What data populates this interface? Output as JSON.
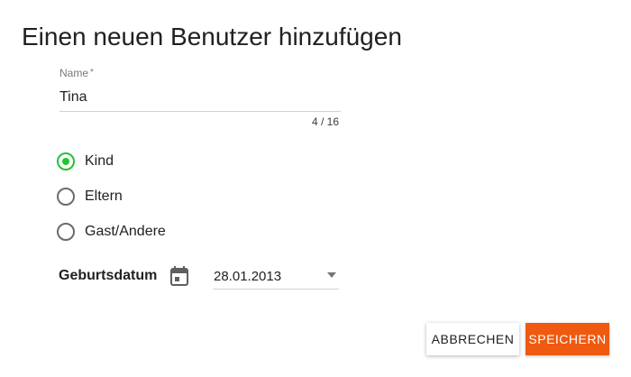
{
  "dialog": {
    "title": "Einen neuen Benutzer hinzufügen"
  },
  "name_field": {
    "label": "Name",
    "required_marker": "*",
    "value": "Tina",
    "counter": "4 / 16"
  },
  "role_options": [
    {
      "label": "Kind",
      "checked": true
    },
    {
      "label": "Eltern",
      "checked": false
    },
    {
      "label": "Gast/Andere",
      "checked": false
    }
  ],
  "birthdate": {
    "label": "Geburtsdatum",
    "value": "28.01.2013",
    "icon": "calendar-icon"
  },
  "buttons": {
    "cancel": "ABBRECHEN",
    "save": "SPEICHERN"
  },
  "colors": {
    "accent_green": "#25c234",
    "primary_orange": "#ef5a10"
  }
}
